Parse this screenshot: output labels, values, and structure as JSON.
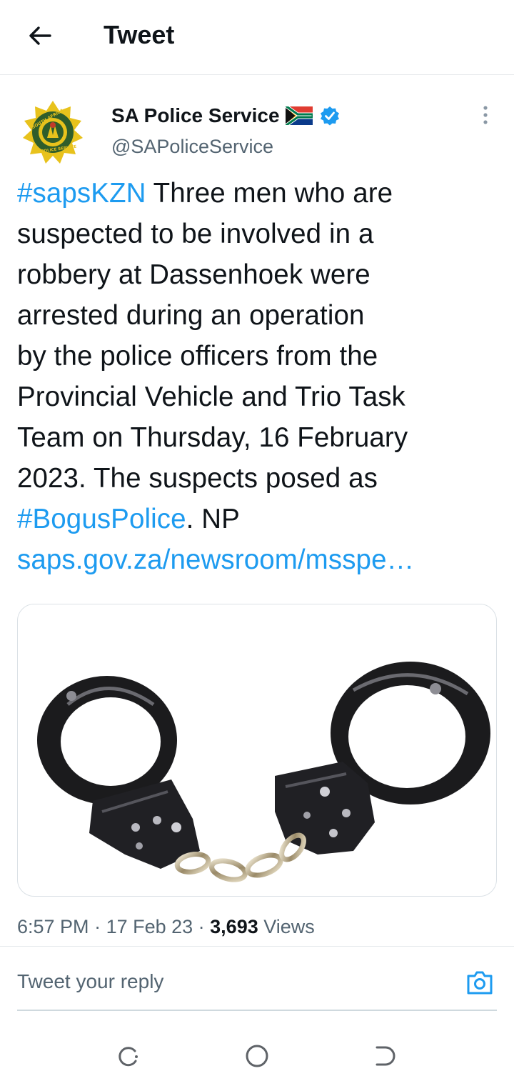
{
  "header": {
    "title": "Tweet",
    "back_icon": "arrow-left-icon"
  },
  "author": {
    "name": "SA Police Service",
    "handle": "@SAPoliceService",
    "badges": [
      "south-africa-flag-icon",
      "verified-icon"
    ],
    "avatar_text_top": "SOUTH AFRICA",
    "avatar_text_bottom": "POLICE SERVICE"
  },
  "tweet": {
    "hashtag1": "#sapsKZN",
    "line1_rest": " Three men who are",
    "line2": "suspected to be involved in a",
    "line3": "robbery at Dassenhoek were",
    "line4": "arrested during an operation",
    "line5": "by the police officers from the",
    "line6": "Provincial Vehicle and Trio Task",
    "line7": "Team on Thursday, 16 February",
    "line8": "2023. The suspects posed as",
    "hashtag2": "#BogusPolice",
    "line9_rest": ".  NP",
    "link": "saps.gov.za/newsroom/msspe…"
  },
  "meta": {
    "time": "6:57 PM",
    "dot": " · ",
    "date": "17 Feb 23",
    "views_count": "3,693",
    "views_label": " Views"
  },
  "reply": {
    "placeholder": "Tweet your reply",
    "camera_icon": "camera-icon"
  },
  "colors": {
    "link": "#1d9bf0",
    "secondary": "#536471",
    "verified": "#1d9bf0"
  },
  "nav": [
    "recent-apps-icon",
    "home-icon",
    "back-nav-icon"
  ]
}
